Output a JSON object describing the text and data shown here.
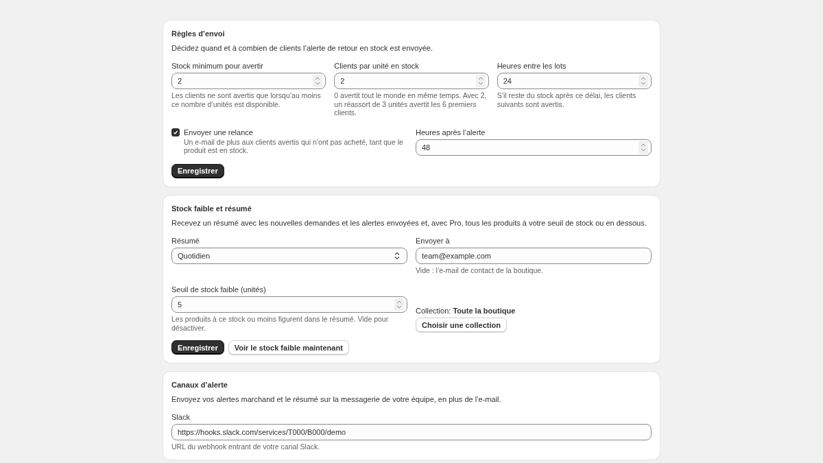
{
  "sections": [
    {
      "title": "Règles d’envoi",
      "description": "Décidez quand et à combien de clients l’alerte de retour en stock est envoyée.",
      "rows": [
        {
          "items": [
            {
              "kind": "number",
              "label": "Stock minimum pour avertir",
              "value": "2",
              "help": "Les clients ne sont avertis que lorsqu’au moins ce nombre d’unités est disponible."
            },
            {
              "kind": "number",
              "label": "Clients par unité en stock",
              "value": "2",
              "help": "0 avertit tout le monde en même temps. Avec 2, un réassort de 3 unités avertit les 6 premiers clients."
            },
            {
              "kind": "number",
              "label": "Heures entre les lots",
              "value": "24",
              "help": "S’il reste du stock après ce délai, les clients suivants sont avertis."
            }
          ]
        },
        {
          "items": [
            {
              "kind": "checkbox",
              "label": "Envoyer une relance",
              "checked": true,
              "help": "Un e-mail de plus aux clients avertis qui n’ont pas acheté, tant que le produit est en stock."
            },
            {
              "kind": "number",
              "label": "Heures après l’alerte",
              "value": "48"
            }
          ]
        }
      ],
      "buttons": [
        {
          "label": "Enregistrer",
          "kind": "primary"
        }
      ]
    },
    {
      "title": "Stock faible et résumé",
      "description": "Recevez un résumé avec les nouvelles demandes et les alertes envoyées et, avec Pro, tous les produits à votre seuil de stock ou en dessous.",
      "rows": [
        {
          "items": [
            {
              "kind": "select",
              "label": "Résumé",
              "value": "Quotidien"
            },
            {
              "kind": "text",
              "label": "Envoyer à",
              "value": "team@example.com",
              "help": "Vide : l’e-mail de contact de la boutique."
            }
          ]
        },
        {
          "items": [
            {
              "kind": "number",
              "label": "Seuil de stock faible (unités)",
              "value": "5",
              "help": "Les produits à ce stock ou moins figurent dans le résumé. Vide pour désactiver."
            },
            {
              "kind": "collection",
              "label": "Collection: **Toute la boutique**",
              "button": "Choisir une collection"
            }
          ]
        }
      ],
      "buttons": [
        {
          "label": "Enregistrer",
          "kind": "primary"
        },
        {
          "label": "Voir le stock faible maintenant",
          "kind": "secondary"
        }
      ]
    },
    {
      "title": "Canaux d’alerte",
      "description": "Envoyez vos alertes marchand et le résumé sur la messagerie de votre équipe, en plus de l’e-mail.",
      "rows": [
        {
          "items": [
            {
              "kind": "text",
              "label": "Slack",
              "value": "https://hooks.slack.com/services/T000/B000/demo",
              "help": "URL du webhook entrant de votre canal Slack."
            }
          ]
        }
      ]
    }
  ]
}
